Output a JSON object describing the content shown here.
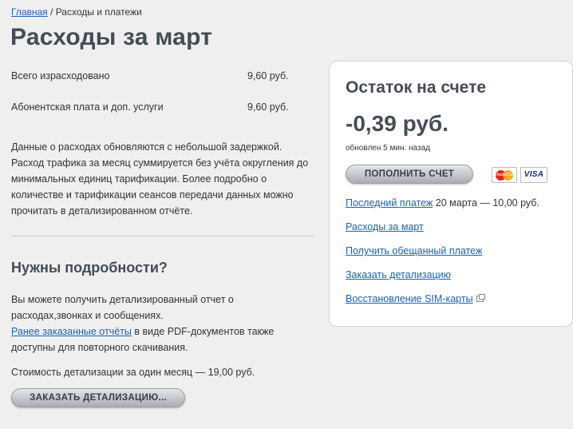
{
  "breadcrumb": {
    "home": "Главная",
    "separator": " / ",
    "current": "Расходы и платежи"
  },
  "page_title": "Расходы за март",
  "summary": [
    {
      "label": "Всего израсходовано",
      "value": "9,60 руб."
    },
    {
      "label": "Абонентская плата и доп. услуги",
      "value": "9,60 руб."
    }
  ],
  "notice": "Данные о расходах обновляются с небольшой задержкой. Расход трафика за месяц суммируется без учёта округления до минимальных единиц тарификации. Более подробно о количестве и тарификации сеансов передачи данных можно прочитать в детализированном отчёте.",
  "details": {
    "title": "Нужны подробности?",
    "text_before": "Вы можете получить детализированный отчет о расходах,звонках и сообщениях.",
    "link": "Ранее заказанные отчёты",
    "text_after": " в виде PDF-документов также доступны для повторного скачивания.",
    "cost": "Стоимость детализации за один месяц — 19,00 руб.",
    "order_button": "ЗАКАЗАТЬ ДЕТАЛИЗАЦИЮ..."
  },
  "balance_card": {
    "title": "Остаток на счете",
    "amount": "-0,39 руб.",
    "updated": "обновлен 5 мин. назад",
    "topup_button": "ПОПОЛНИТЬ СЧЕТ",
    "mastercard_label": "MasterCard",
    "visa_label": "VISA",
    "last_payment_link": "Последний платеж",
    "last_payment_text": " 20 марта — 10,00 руб.",
    "links": [
      "Расходы за март",
      "Получить обещанный платеж",
      "Заказать детализацию",
      "Восстановление SIM-карты"
    ]
  },
  "colors": {
    "link": "#1b62b5",
    "heading": "#454c55",
    "background": "#efefef",
    "card": "#ffffff"
  },
  "icons": {
    "external": "external-window-icon"
  }
}
